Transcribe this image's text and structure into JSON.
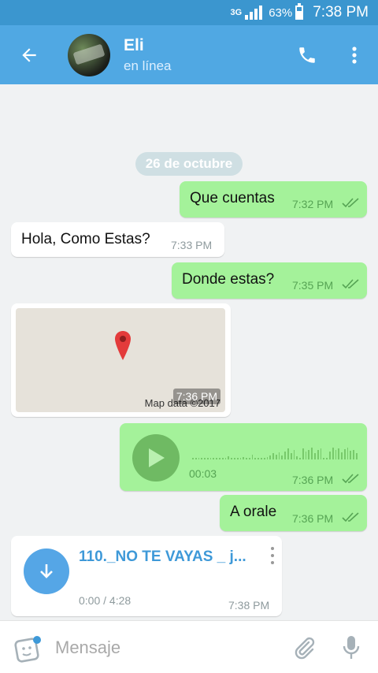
{
  "status_bar": {
    "network": "3G",
    "battery": "63%",
    "time": "7:38 PM"
  },
  "header": {
    "name": "Eli",
    "status": "en línea"
  },
  "date_chip": "26 de octubre",
  "messages": [
    {
      "type": "text",
      "direction": "out",
      "text": "Que cuentas",
      "time": "7:32 PM",
      "read": true
    },
    {
      "type": "text",
      "direction": "in",
      "text": "Hola, Como Estas?",
      "time": "7:33 PM"
    },
    {
      "type": "text",
      "direction": "out",
      "text": "Donde estas?",
      "time": "7:35 PM",
      "read": true
    },
    {
      "type": "location",
      "direction": "in",
      "credit": "Map data ©2017",
      "time": "7:36 PM"
    },
    {
      "type": "voice",
      "direction": "out",
      "duration": "00:03",
      "time": "7:36 PM",
      "read": true
    },
    {
      "type": "text",
      "direction": "out",
      "text": "A orale",
      "time": "7:36 PM",
      "read": true
    },
    {
      "type": "audio_file",
      "direction": "in",
      "title": "110._NO TE VAYAS _ j...",
      "progress": "0:00 / 4:28",
      "time": "7:38 PM"
    }
  ],
  "composer": {
    "placeholder": "Mensaje"
  },
  "colors": {
    "header": "#50a8e3",
    "outgoing_bubble": "#a4f29a",
    "incoming_bubble": "#ffffff",
    "accent": "#3e99d8"
  }
}
